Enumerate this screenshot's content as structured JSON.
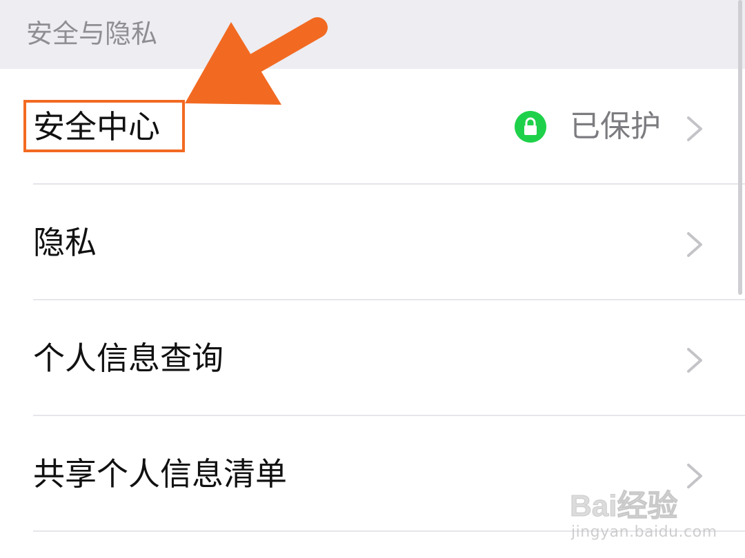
{
  "section": {
    "title": "安全与隐私"
  },
  "rows": [
    {
      "label": "安全中心",
      "status": "已保护",
      "status_icon": "lock-icon",
      "chevron": "chevron-right-icon"
    },
    {
      "label": "隐私",
      "chevron": "chevron-right-icon"
    },
    {
      "label": "个人信息查询",
      "chevron": "chevron-right-icon"
    },
    {
      "label": "共享个人信息清单",
      "chevron": "chevron-right-icon"
    }
  ],
  "annotation": {
    "arrow_color": "#f26a22",
    "highlight_color": "#f26a22"
  },
  "watermark": {
    "brand": "Bai经验",
    "url": "jingyan.baidu.com"
  },
  "colors": {
    "status_green": "#1fd14a",
    "header_bg": "#ededf2"
  }
}
